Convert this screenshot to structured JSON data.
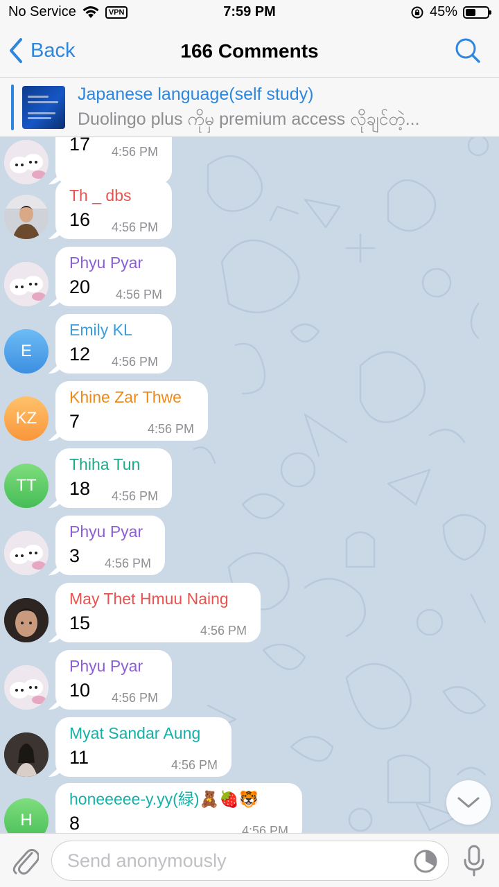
{
  "status_bar": {
    "carrier": "No Service",
    "vpn": "VPN",
    "time": "7:59 PM",
    "battery": "45%",
    "battery_level": 0.45
  },
  "nav": {
    "back_label": "Back",
    "title": "166 Comments"
  },
  "pinned": {
    "title": "Japanese language(self study)",
    "subtitle": "Duolingo plus ကိုမှ premium access လိုချင်တဲ့..."
  },
  "messages": [
    {
      "sender": "",
      "text": "17",
      "time": "4:56 PM",
      "avatar": "photo-cat"
    },
    {
      "sender": "Th _ dbs",
      "text": "16",
      "time": "4:56 PM",
      "color": "#e8534f",
      "avatar": "photo-man"
    },
    {
      "sender": "Phyu Pyar",
      "text": "20",
      "time": "4:56 PM",
      "color": "#8d5ed6",
      "avatar": "photo-cat"
    },
    {
      "sender": "Emily KL",
      "text": "12",
      "time": "4:56 PM",
      "color": "#3d9ddc",
      "avatar_initials": "E",
      "avatar_color": "#4aa4ee"
    },
    {
      "sender": "Khine Zar Thwe",
      "text": "7",
      "time": "4:56 PM",
      "color": "#ee8a1a",
      "avatar_initials": "KZ",
      "avatar_color": "#fca94f"
    },
    {
      "sender": "Thiha Tun",
      "text": "18",
      "time": "4:56 PM",
      "color": "#1fa98c",
      "avatar_initials": "TT",
      "avatar_color": "#5ccb64"
    },
    {
      "sender": "Phyu Pyar",
      "text": "3",
      "time": "4:56 PM",
      "color": "#8d5ed6",
      "avatar": "photo-cat"
    },
    {
      "sender": "May Thet Hmuu Naing",
      "text": "15",
      "time": "4:56 PM",
      "color": "#e8534f",
      "avatar": "photo-face"
    },
    {
      "sender": "Phyu Pyar",
      "text": "10",
      "time": "4:56 PM",
      "color": "#8d5ed6",
      "avatar": "photo-cat"
    },
    {
      "sender": "Myat Sandar Aung",
      "text": "11",
      "time": "4:56 PM",
      "color": "#16b0a6",
      "avatar": "photo-mirror"
    },
    {
      "sender": "honeeeee-y.yy(緑)🧸🍓🐯",
      "text": "8",
      "time": "4:56 PM",
      "color": "#16b0a6",
      "avatar_initials": "H",
      "avatar_color": "#5ccb64"
    }
  ],
  "input": {
    "placeholder": "Send anonymously"
  },
  "icons": {
    "back": "chevron-left-icon",
    "search": "search-icon",
    "attach": "paperclip-icon",
    "timer": "timer-icon",
    "mic": "microphone-icon",
    "scroll_down": "chevron-down-icon"
  },
  "colors": {
    "accent": "#2e86de",
    "chat_background": "#cbd9e7"
  }
}
